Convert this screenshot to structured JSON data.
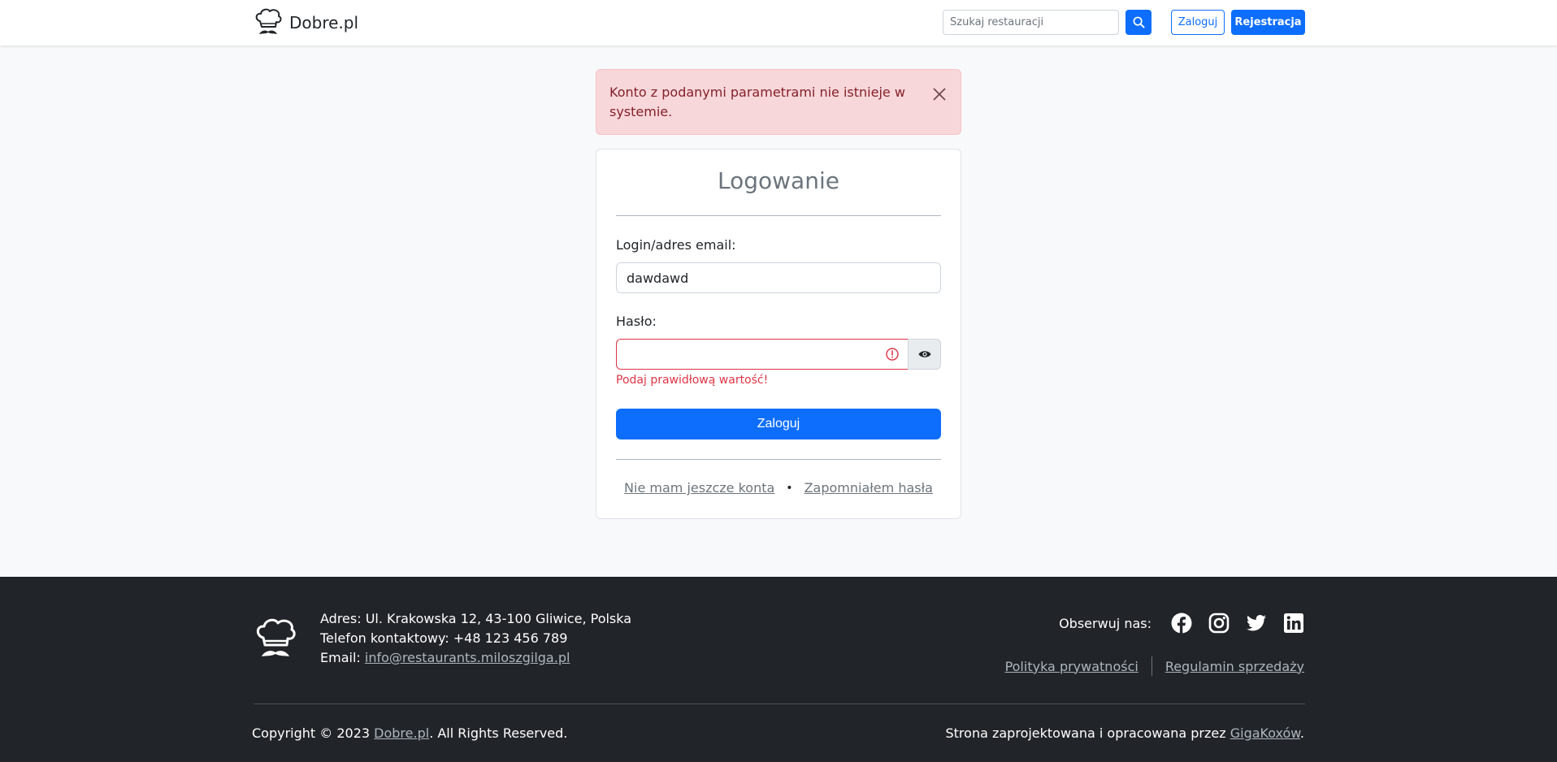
{
  "header": {
    "brand": "Dobre.pl",
    "search_placeholder": "Szukaj restauracji",
    "login_label": "Zaloguj",
    "register_label": "Rejestracja"
  },
  "alert": {
    "message": "Konto z podanymi parametrami nie istnieje w systemie."
  },
  "login_form": {
    "title": "Logowanie",
    "login_label": "Login/adres email:",
    "login_value": "dawdawd",
    "password_label": "Hasło:",
    "password_value": "",
    "password_error": "Podaj prawidłową wartość!",
    "submit_label": "Zaloguj",
    "no_account_link": "Nie mam jeszcze konta",
    "forgot_password_link": "Zapomniałem hasła",
    "separator": "•"
  },
  "footer": {
    "address": "Adres: Ul. Krakowska 12, 43-100 Gliwice, Polska",
    "phone": "Telefon kontaktowy: +48 123 456 789",
    "email_label": "Email: ",
    "email_value": "info@restaurants.miloszgilga.pl",
    "follow_label": "Obserwuj nas:",
    "social_icons": [
      "facebook-icon",
      "instagram-icon",
      "twitter-icon",
      "linkedin-icon"
    ],
    "privacy_link": "Polityka prywatności",
    "terms_link": "Regulamin sprzedaży",
    "copyright_prefix": "Copyright © 2023 ",
    "copyright_link": "Dobre.pl",
    "copyright_suffix": ". All Rights Reserved.",
    "designed_prefix": "Strona zaprojektowana i opracowana przez ",
    "designed_link": "GigaKoxów",
    "designed_suffix": "."
  },
  "colors": {
    "primary": "#0d6efd",
    "danger": "#dc3545",
    "alert_bg": "#f8d7da",
    "alert_text": "#842029",
    "footer_bg": "#212529",
    "page_bg": "#f8f9fa"
  }
}
